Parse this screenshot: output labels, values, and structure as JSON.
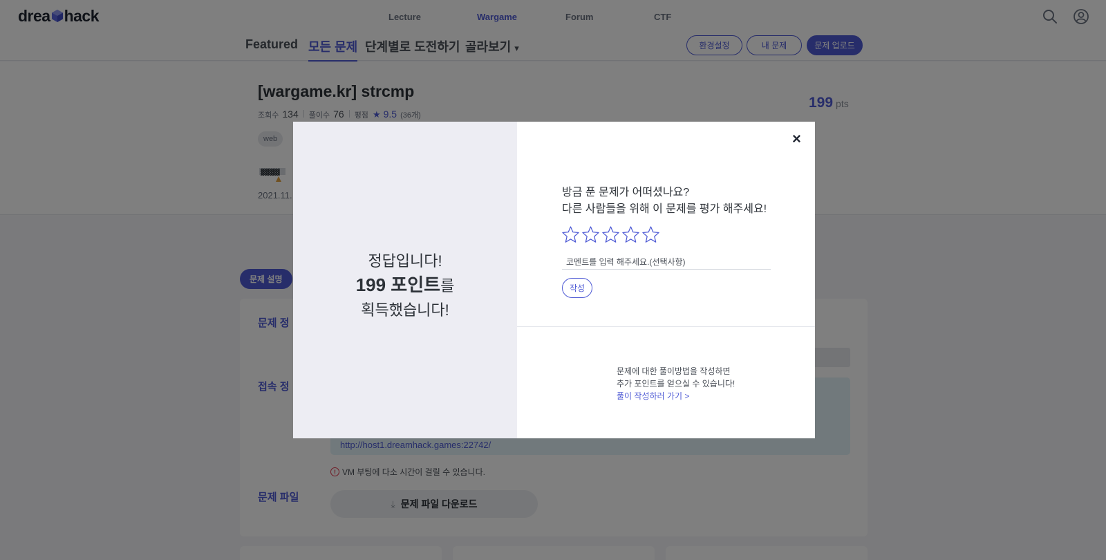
{
  "brand": {
    "logo_left": "drea",
    "logo_right": "hack"
  },
  "nav": {
    "items": [
      "Lecture",
      "Wargame",
      "Forum",
      "CTF"
    ],
    "active": "Wargame"
  },
  "subnav": {
    "tabs": [
      "Featured",
      "모든 문제",
      "단계별로 도전하기",
      "골라보기"
    ],
    "dropdown_caret": "▾",
    "buttons": {
      "settings": "환경설정",
      "my_problems": "내 문제",
      "upload": "문제 업로드"
    }
  },
  "challenge": {
    "title": "[wargame.kr] strcmp",
    "views_label": "조회수",
    "views": "134",
    "solves_label": "풀이수",
    "solves": "76",
    "rating_label": "평점",
    "rating": "9.5",
    "rating_count": "(36개)",
    "tag": "web",
    "date": "2021.11.",
    "points": "199",
    "points_unit": "pts"
  },
  "content": {
    "tab_description": "문제 설명",
    "sec_info": "문제 정",
    "sec_access": "접속 정",
    "sec_file": "문제 파일",
    "access_url": "http://host1.dreamhack.games:22742/",
    "vm_note": "VM 부팅에 다소 시간이 걸릴 수 있습니다.",
    "download_label": "문제 파일 다운로드"
  },
  "modal": {
    "left_line1": "정답입니다!",
    "left_points": "199 포인트",
    "left_particle": "를",
    "left_line3": "획득했습니다!",
    "question_line1": "방금 푼 문제가 어떠셨나요?",
    "question_line2": "다른 사람들을 위해 이 문제를 평가 해주세요!",
    "star_count": 5,
    "rating_value": 0,
    "comment_placeholder": "코멘트를 입력 해주세요.(선택사항)",
    "comment_value": "",
    "submit_label": "작성",
    "writeup_line1": "문제에 대한 풀이방법을 작성하면",
    "writeup_line2": "추가 포인트를 얻으실 수 있습니다!",
    "writeup_link": "풀이 작성하러 가기 >",
    "close_glyph": "×"
  },
  "colors": {
    "accent": "#4f5bd5",
    "overlay": "rgba(0,0,0,0.5)",
    "modal_left_bg": "#ededf3"
  },
  "icons": [
    "search-icon",
    "user-icon",
    "star-icon",
    "share-icon",
    "download-icon",
    "warning-icon",
    "close-icon"
  ]
}
